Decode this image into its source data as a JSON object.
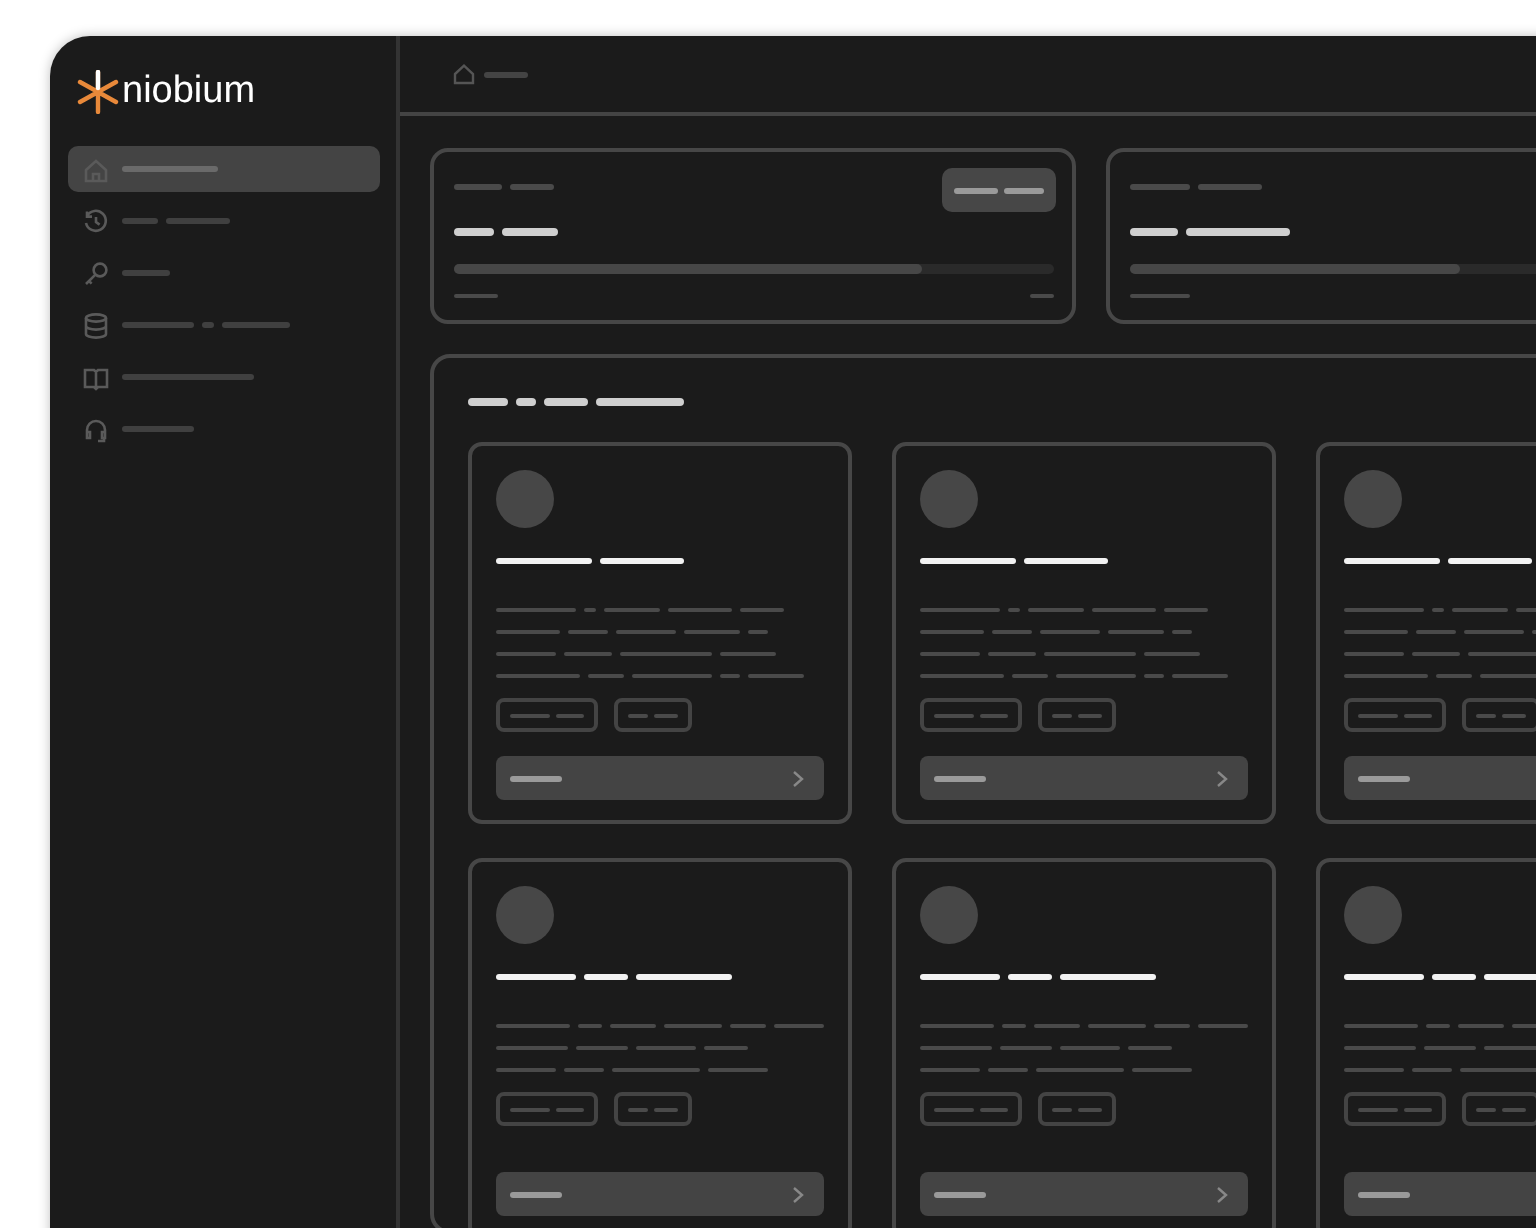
{
  "brand": {
    "name": "niobium"
  },
  "sidebar": {
    "items": [
      {
        "kind": "home",
        "selected": true
      },
      {
        "kind": "history",
        "selected": false
      },
      {
        "kind": "key",
        "selected": false
      },
      {
        "kind": "database",
        "selected": false
      },
      {
        "kind": "book",
        "selected": false
      },
      {
        "kind": "headset",
        "selected": false
      }
    ]
  },
  "breadcrumb": {
    "kind": "home"
  },
  "stat_cards": [
    {
      "kind": "with_button",
      "level": 0.78
    },
    {
      "kind": "plain",
      "level": 0.55
    }
  ],
  "cards": [
    {
      "kind": "skeleton"
    },
    {
      "kind": "skeleton"
    },
    {
      "kind": "skeleton"
    },
    {
      "kind": "skeleton"
    },
    {
      "kind": "skeleton"
    },
    {
      "kind": "skeleton"
    }
  ]
}
